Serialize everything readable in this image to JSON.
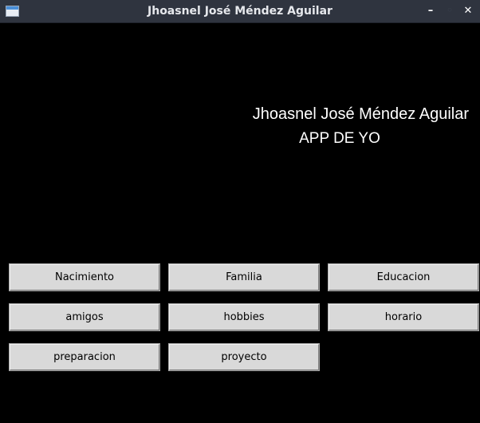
{
  "window": {
    "title": "Jhoasnel José Méndez Aguilar",
    "controls": {
      "minimize": "–",
      "maximize": "◦",
      "close": "✕"
    }
  },
  "header": {
    "name": "Jhoasnel José Méndez Aguilar",
    "subtitle": "APP DE YO"
  },
  "buttons": [
    "Nacimiento",
    "Familia",
    "Educacion",
    "amigos",
    "hobbies",
    "horario",
    "preparacion",
    "proyecto"
  ],
  "colors": {
    "background": "#000000",
    "titlebar": "#2f343f",
    "button_face": "#d9d9d9",
    "header_text": "#ffffff"
  }
}
